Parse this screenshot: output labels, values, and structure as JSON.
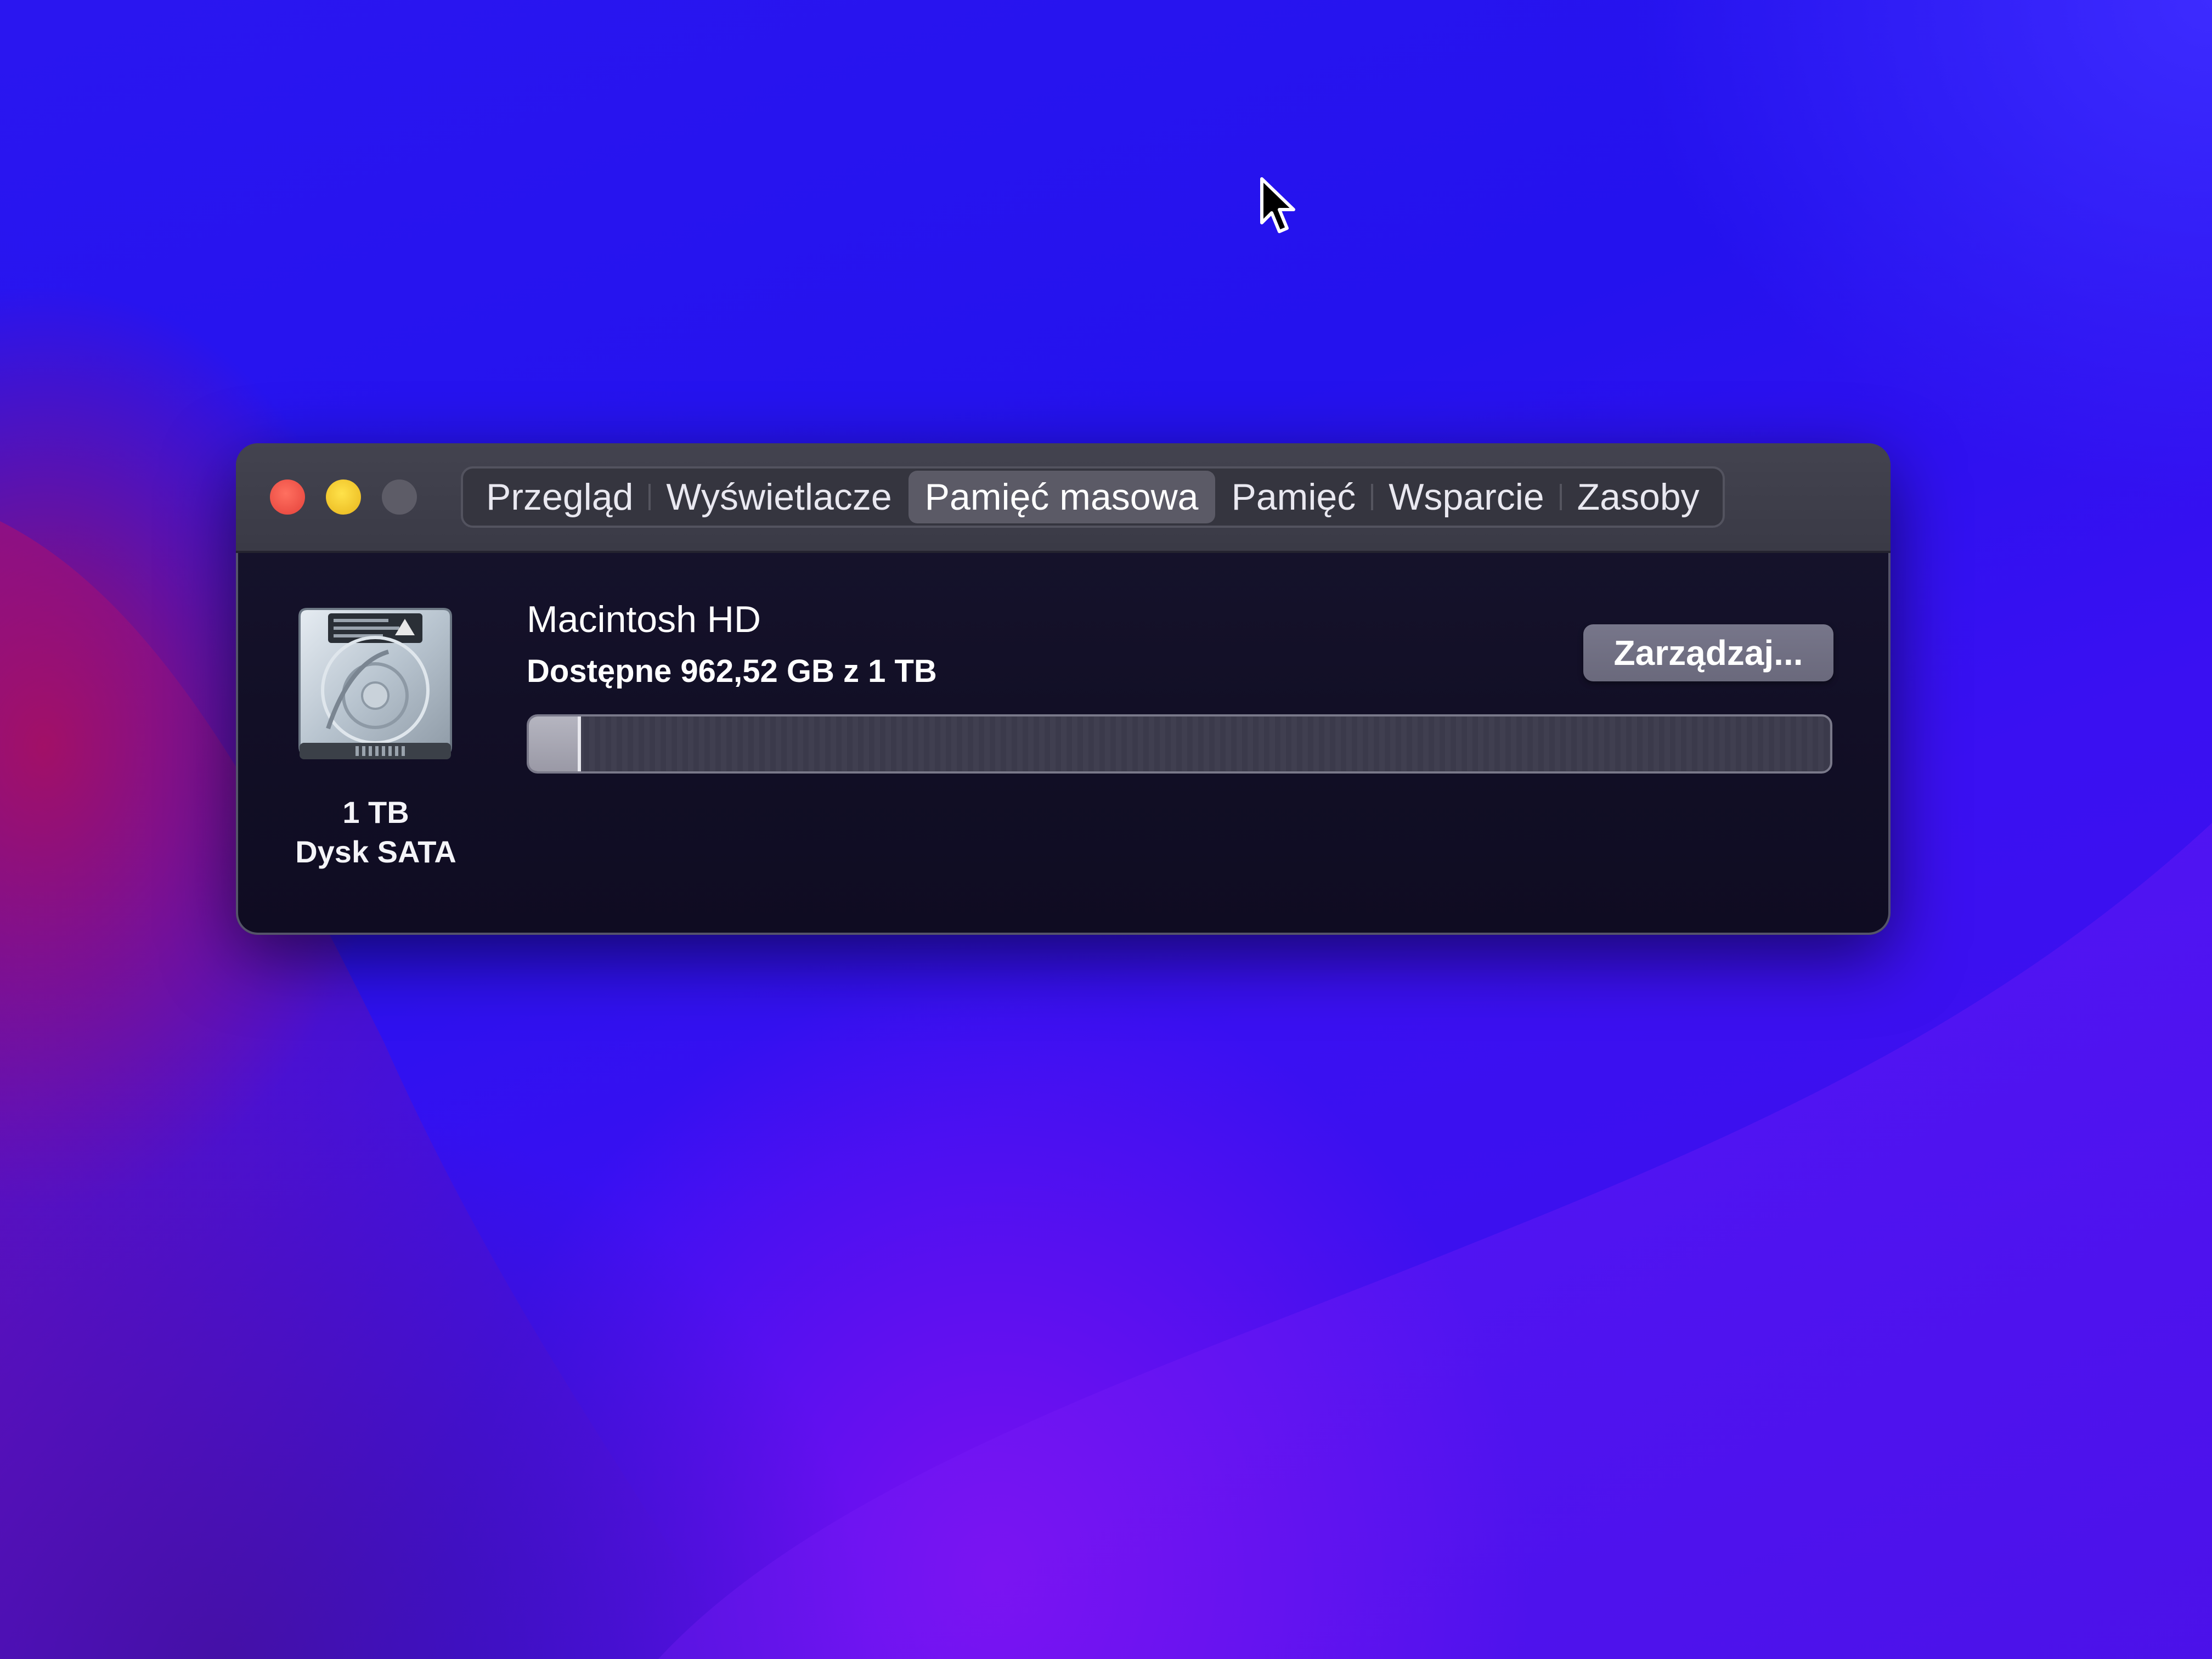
{
  "window": {
    "tabs": [
      {
        "label": "Przegląd",
        "active": false
      },
      {
        "label": "Wyświetlacze",
        "active": false
      },
      {
        "label": "Pamięć masowa",
        "active": true
      },
      {
        "label": "Pamięć",
        "active": false
      },
      {
        "label": "Wsparcie",
        "active": false
      },
      {
        "label": "Zasoby",
        "active": false
      }
    ]
  },
  "disk": {
    "icon": "hard-drive-icon",
    "size": "1 TB",
    "type": "Dysk SATA"
  },
  "volume": {
    "name": "Macintosh HD",
    "available": "Dostępne 962,52 GB z 1 TB",
    "used_fraction": 0.0375,
    "manage_label": "Zarządzaj..."
  },
  "colors": {
    "close": "#e4413a",
    "minimize": "#e8b51c",
    "zoom_disabled": "#5d5c67",
    "wallpaper": "#2a16f0"
  }
}
